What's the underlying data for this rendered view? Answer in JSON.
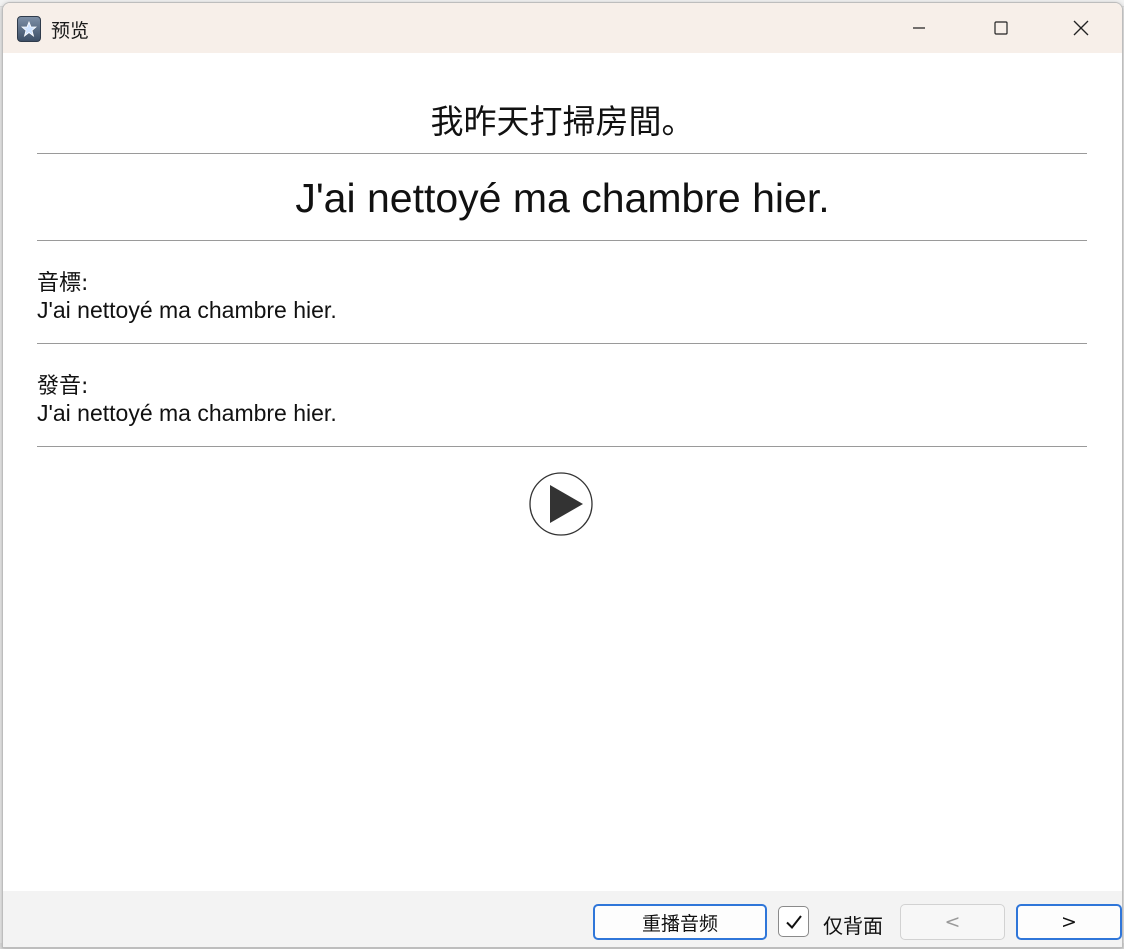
{
  "window": {
    "title": "预览"
  },
  "card": {
    "front": "我昨天打掃房間。",
    "back": "J'ai nettoyé ma chambre hier.",
    "fields": [
      {
        "label": "音標:",
        "value": "J'ai nettoyé ma chambre hier."
      },
      {
        "label": "發音:",
        "value": "J'ai nettoyé ma chambre hier."
      }
    ]
  },
  "footer": {
    "replay_label": "重播音频",
    "back_only_label": "仅背面",
    "back_only_checked": true,
    "prev_label": "<",
    "next_label": ">"
  },
  "icons": {
    "app": "app-icon",
    "minimize": "minimize-icon",
    "maximize": "maximize-icon",
    "close": "close-icon",
    "play": "play-icon",
    "check": "checkmark-icon"
  },
  "colors": {
    "titlebar": "#f7efe9",
    "accent": "#2f76d9",
    "divider": "#9a9a9a"
  }
}
